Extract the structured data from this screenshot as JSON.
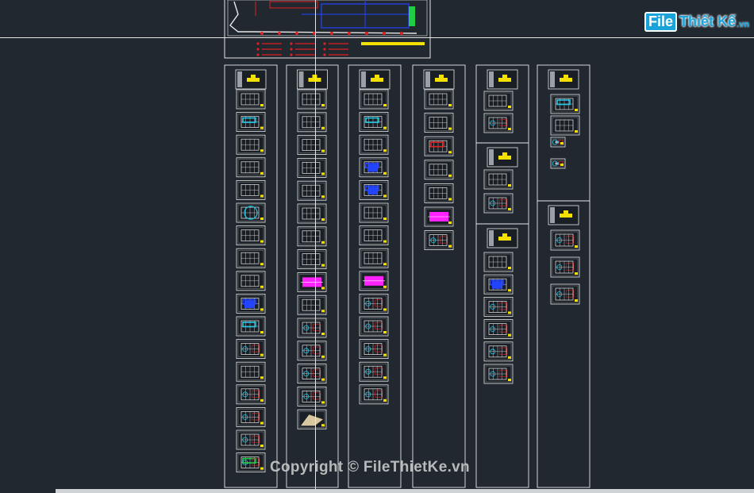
{
  "viewport": {
    "background": "#212830",
    "frame_color": "#e8e8e8"
  },
  "brand": {
    "logo_box": "File",
    "logo_text": "Thiết Kế",
    "logo_domain": ".vn",
    "watermark": "Copyright © FileThietKe.vn"
  },
  "colors": {
    "title_block_yellow": "#f3e000",
    "drawing_white": "#e8e8e8",
    "drawing_cyan": "#22c8e8",
    "drawing_magenta": "#ff22ff",
    "drawing_blue": "#2244ff",
    "drawing_green": "#22cc44",
    "drawing_red": "#e02020"
  },
  "layout_groups": [
    {
      "group": "column-1",
      "sheet_types": [
        "plan",
        "plan-cyan",
        "plan",
        "plan",
        "elevation",
        "site",
        "section",
        "section",
        "plan",
        "plan-blue",
        "plan-cyan",
        "detail",
        "section",
        "detail",
        "detail",
        "detail",
        "detail-green"
      ]
    },
    {
      "group": "column-2",
      "sheet_types": [
        "plan",
        "plan",
        "plan",
        "plan",
        "elevation",
        "section",
        "section",
        "section",
        "magenta",
        "elevation",
        "detail",
        "detail",
        "detail",
        "detail",
        "render"
      ]
    },
    {
      "group": "column-3",
      "sheet_types": [
        "plan",
        "plan-cyan",
        "plan",
        "plan-blue",
        "plan-blue",
        "elevation",
        "section",
        "section",
        "magenta",
        "detail",
        "detail",
        "detail",
        "detail",
        "detail"
      ]
    },
    {
      "group": "column-4",
      "sheet_types": [
        "plan",
        "plan",
        "plan-red",
        "section",
        "section",
        "magenta",
        "detail"
      ]
    },
    {
      "group": "column-5a",
      "sheet_types": [
        "plan",
        "detail"
      ]
    },
    {
      "group": "column-5b",
      "sheet_types": [
        "plan",
        "detail"
      ]
    },
    {
      "group": "column-5c",
      "sheet_types": [
        "plan",
        "plan-blue",
        "detail",
        "detail",
        "detail",
        "detail"
      ]
    },
    {
      "group": "column-6a",
      "sheet_types": [
        "plan-cyan",
        "plan",
        "detail-small",
        "detail-small"
      ]
    },
    {
      "group": "column-6b",
      "sheet_types": [
        "detail",
        "detail",
        "detail"
      ]
    }
  ]
}
